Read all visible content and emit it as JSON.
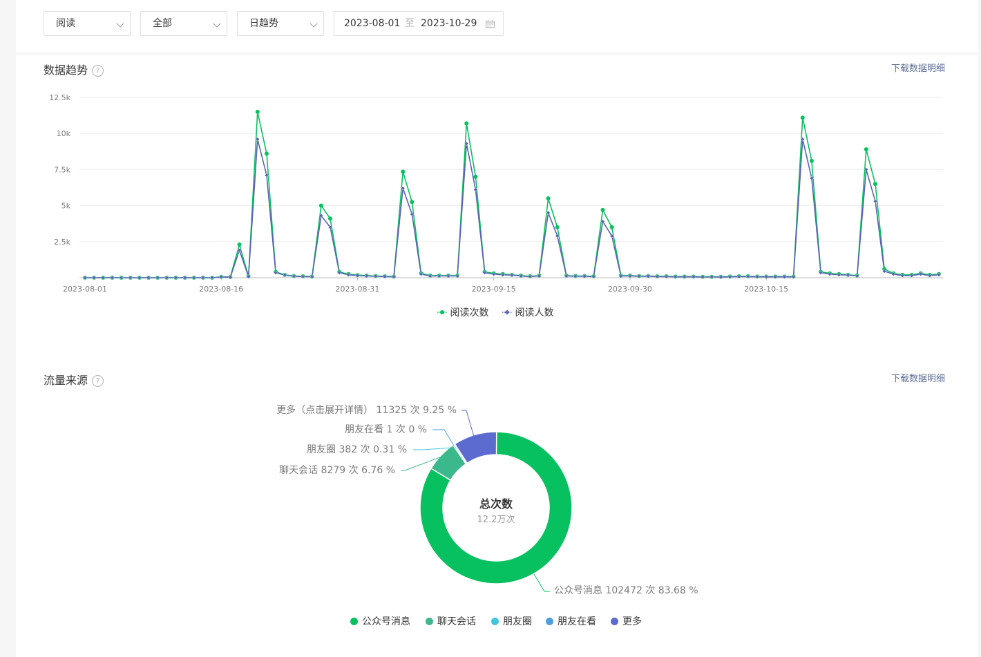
{
  "filters": {
    "metric": "阅读",
    "scope": "全部",
    "granularity": "日趋势",
    "date_start": "2023-08-01",
    "date_sep": "至",
    "date_end": "2023-10-29"
  },
  "trend_section": {
    "title": "数据趋势",
    "help": "?",
    "download": "下载数据明细",
    "legend": [
      "阅读次数",
      "阅读人数"
    ],
    "x_ticks": [
      "2023-08-01",
      "2023-08-16",
      "2023-08-31",
      "2023-09-15",
      "2023-09-30",
      "2023-10-15"
    ],
    "y_ticks": [
      "2.5k",
      "5k",
      "7.5k",
      "10k",
      "12.5k"
    ]
  },
  "source_section": {
    "title": "流量来源",
    "help": "?",
    "download": "下载数据明细",
    "center_title": "总次数",
    "center_value": "12.2万次",
    "labels": {
      "more": "更多（点击展开详情） 11325 次 9.25 %",
      "moments_watch": "朋友在看 1 次 0 %",
      "moments": "朋友圈 382 次 0.31 %",
      "chat": "聊天会话 8279 次 6.76 %",
      "official": "公众号消息 102472 次 83.68 %"
    },
    "legend": [
      "公众号消息",
      "聊天会话",
      "朋友圈",
      "朋友在看",
      "更多"
    ]
  },
  "colors": {
    "green": "#07c160",
    "purple": "#5a62b3",
    "teal": "#3bb98c",
    "cyan": "#43c5dd",
    "blue": "#4f9fe0",
    "indigo": "#5b6bcf",
    "link": "#576b95"
  },
  "chart_data": [
    {
      "type": "line",
      "title": "数据趋势",
      "xlabel": "",
      "ylabel": "",
      "x_start": "2023-08-01",
      "x_end": "2023-10-29",
      "ylim": [
        0,
        12500
      ],
      "grid": true,
      "legend_position": "bottom",
      "series": [
        {
          "name": "阅读次数",
          "color": "#07c160",
          "values": [
            0,
            0,
            0,
            0,
            0,
            0,
            0,
            0,
            0,
            0,
            0,
            0,
            0,
            0,
            0,
            60,
            50,
            2300,
            100,
            11500,
            8600,
            400,
            200,
            120,
            100,
            80,
            5000,
            4100,
            400,
            250,
            180,
            150,
            120,
            100,
            80,
            7350,
            5250,
            300,
            150,
            150,
            150,
            150,
            10700,
            7000,
            400,
            300,
            250,
            200,
            150,
            100,
            150,
            5500,
            3500,
            150,
            120,
            120,
            100,
            4700,
            3500,
            150,
            150,
            120,
            120,
            100,
            100,
            80,
            80,
            80,
            60,
            60,
            60,
            80,
            100,
            100,
            80,
            80,
            80,
            80,
            80,
            11100,
            8100,
            400,
            300,
            250,
            200,
            150,
            8900,
            6500,
            600,
            300,
            200,
            200,
            300,
            200,
            250
          ]
        },
        {
          "name": "阅读人数",
          "color": "#5a62b3",
          "values": [
            0,
            0,
            0,
            0,
            0,
            0,
            0,
            0,
            0,
            0,
            0,
            0,
            0,
            0,
            0,
            50,
            40,
            1900,
            80,
            9600,
            7100,
            350,
            180,
            100,
            80,
            70,
            4300,
            3500,
            350,
            200,
            150,
            120,
            100,
            80,
            70,
            6200,
            4400,
            250,
            120,
            120,
            120,
            120,
            9300,
            6100,
            350,
            250,
            200,
            180,
            120,
            80,
            120,
            4500,
            2900,
            120,
            100,
            100,
            80,
            3900,
            2900,
            120,
            120,
            100,
            100,
            80,
            80,
            60,
            60,
            60,
            50,
            50,
            50,
            60,
            80,
            80,
            60,
            60,
            60,
            60,
            60,
            9600,
            6900,
            350,
            250,
            200,
            180,
            120,
            7500,
            5300,
            450,
            250,
            150,
            150,
            250,
            150,
            200
          ]
        }
      ]
    },
    {
      "type": "pie",
      "title": "流量来源",
      "total_label": "总次数",
      "total_value": "12.2万次",
      "categories": [
        "公众号消息",
        "聊天会话",
        "朋友圈",
        "朋友在看",
        "更多（点击展开详情）"
      ],
      "values": [
        102472,
        8279,
        382,
        1,
        11325
      ],
      "percent": [
        83.68,
        6.76,
        0.31,
        0,
        9.25
      ],
      "colors": [
        "#07c160",
        "#3bb98c",
        "#43c5dd",
        "#4f9fe0",
        "#5b6bcf"
      ],
      "legend_position": "bottom"
    }
  ]
}
